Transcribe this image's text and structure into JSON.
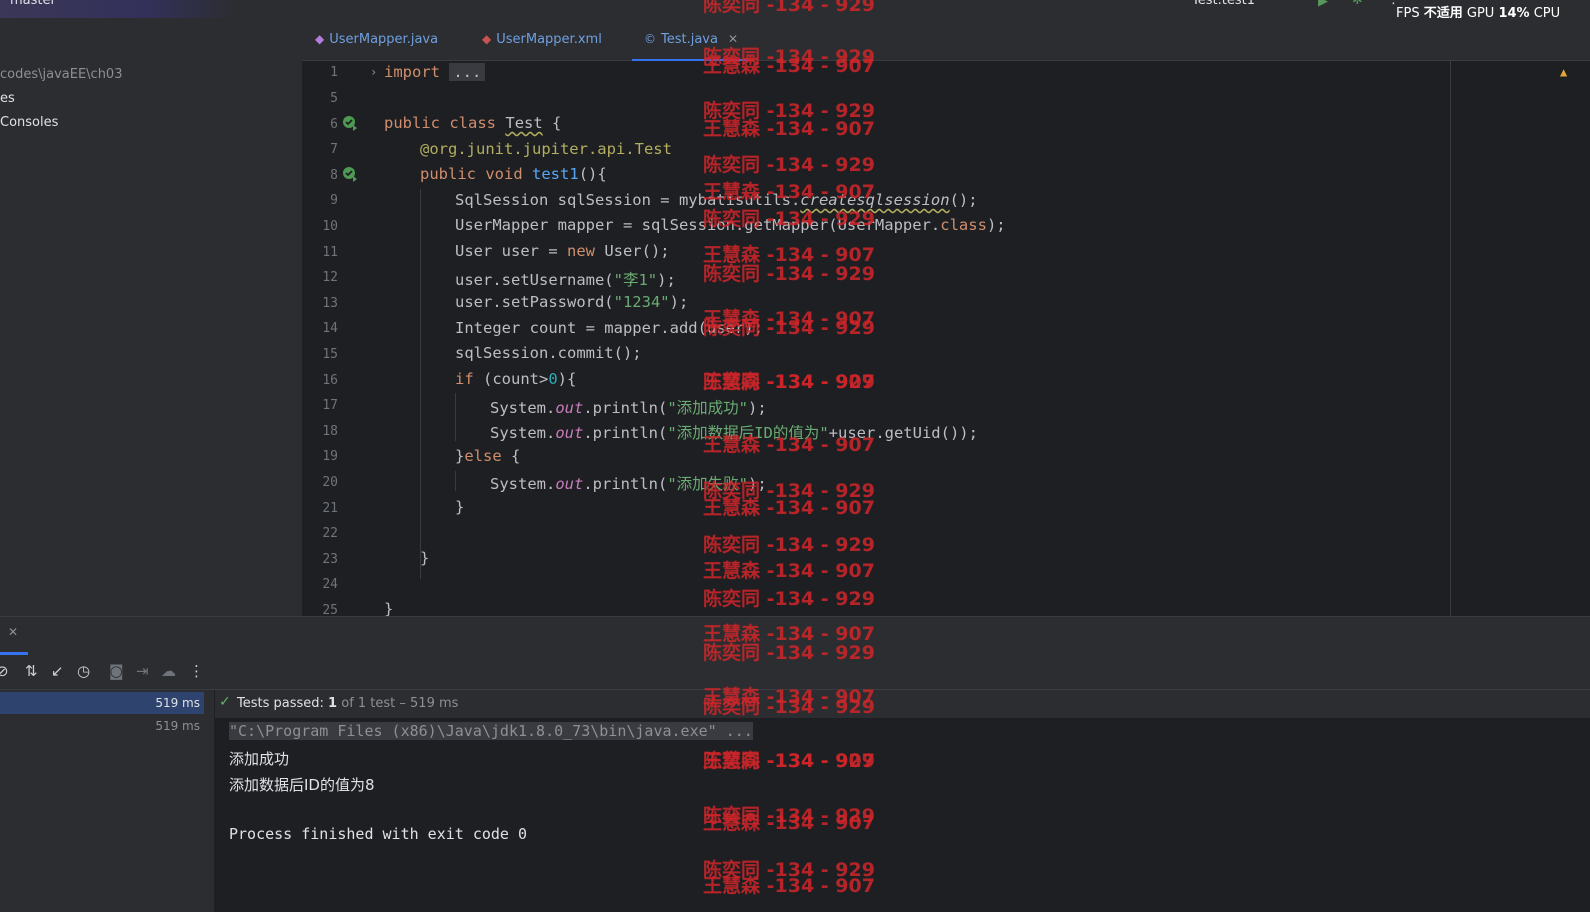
{
  "topbar": {
    "branch": "master",
    "run_config": "Test.test1",
    "perf_fps": "FPS",
    "perf_na": "不适用",
    "perf_gpu": "GPU",
    "perf_cpu_pct": "14%",
    "perf_cpu": "CPU"
  },
  "project": {
    "items": [
      {
        "label": "codes\\javaEE\\ch03"
      },
      {
        "label": "es"
      },
      {
        "label": "Consoles"
      }
    ]
  },
  "tabs": [
    {
      "label": "UserMapper.java",
      "icon": "java-interface-icon"
    },
    {
      "label": "UserMapper.xml",
      "icon": "xml-mapper-icon"
    },
    {
      "label": "Test.java",
      "icon": "java-class-icon",
      "active": true
    }
  ],
  "editor": {
    "line_numbers": [
      "1",
      "5",
      "6",
      "7",
      "8",
      "9",
      "10",
      "11",
      "12",
      "13",
      "14",
      "15",
      "16",
      "17",
      "18",
      "19",
      "20",
      "21",
      "22",
      "23",
      "24",
      "25"
    ],
    "code": {
      "l1_kw": "import",
      "l1_fold": "...",
      "l6_a": "public",
      "l6_b": "class",
      "l6_c": "Test",
      "l6_d": "{",
      "l7_a": "@org.junit.jupiter.api.",
      "l7_b": "Test",
      "l8_a": "public",
      "l8_b": "void",
      "l8_c": "test1",
      "l8_d": "(){",
      "l9_a": "SqlSession sqlSession = mybatisutils.",
      "l9_b": "createsqlsession",
      "l9_c": "();",
      "l10_a": "UserMapper mapper = sqlSession.getMapper(UserMapper.",
      "l10_b": "class",
      "l10_c": ");",
      "l11_a": "User user = ",
      "l11_b": "new",
      "l11_c": " User();",
      "l12_a": "user.setUsername(",
      "l12_b": "\"李1\"",
      "l12_c": ");",
      "l13_a": "user.setPassword(",
      "l13_b": "\"1234\"",
      "l13_c": ");",
      "l14": "Integer count = mapper.add(user);",
      "l15": "sqlSession.commit();",
      "l16_a": "if",
      "l16_b": " (count>",
      "l16_c": "0",
      "l16_d": "){",
      "l17_a": "System.",
      "l17_b": "out",
      "l17_c": ".println(",
      "l17_d": "\"添加成功\"",
      "l17_e": ");",
      "l18_a": "System.",
      "l18_b": "out",
      "l18_c": ".println(",
      "l18_d": "\"添加数据后ID的值为\"",
      "l18_e": "+user.getUid());",
      "l19_a": "}",
      "l19_b": "else",
      "l19_c": " {",
      "l20_a": "System.",
      "l20_b": "out",
      "l20_c": ".println(",
      "l20_d": "\"添加失败\"",
      "l20_e": ");",
      "l21": "}",
      "l23": "}",
      "l25": "}"
    }
  },
  "tests": {
    "tree": [
      {
        "time": "519 ms",
        "selected": true
      },
      {
        "time": "519 ms",
        "selected": false
      }
    ],
    "status_check": "✓",
    "status_passed": "Tests passed:",
    "status_count": "1",
    "status_rest": "of 1 test – 519 ms"
  },
  "console": {
    "lines": [
      "\"C:\\Program Files (x86)\\Java\\jdk1.8.0_73\\bin\\java.exe\" ...",
      "添加成功",
      "添加数据后ID的值为8",
      "",
      "Process finished with exit code 0"
    ]
  },
  "watermarks": {
    "a": "陈奕同 -134 - 929",
    "b": "王慧森 -134 - 907"
  },
  "colors": {
    "accent": "#3574f0",
    "watermark": "#d0262a",
    "pass": "#5fb865"
  }
}
